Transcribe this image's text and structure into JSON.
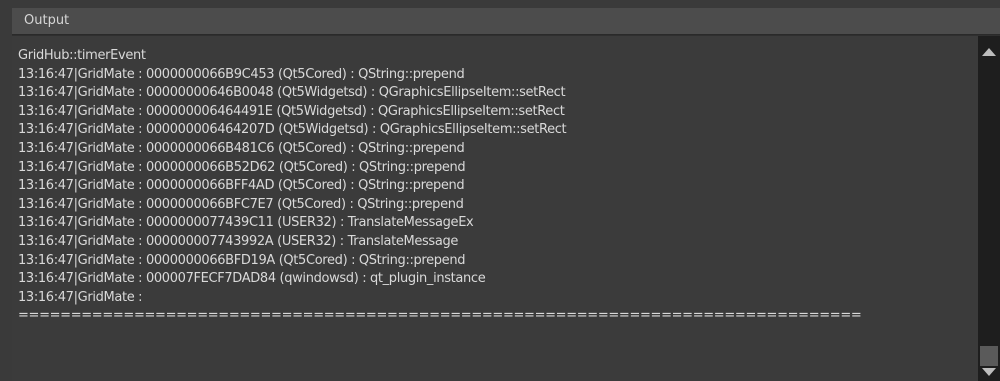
{
  "panel": {
    "title": "Output"
  },
  "log": {
    "lines": [
      "GridHub::timerEvent",
      "13:16:47|GridMate : 0000000066B9C453 (Qt5Cored) : QString::prepend",
      "13:16:47|GridMate : 00000000646B0048 (Qt5Widgetsd) : QGraphicsEllipseItem::setRect",
      "13:16:47|GridMate : 000000006464491E (Qt5Widgetsd) : QGraphicsEllipseItem::setRect",
      "13:16:47|GridMate : 000000006464207D (Qt5Widgetsd) : QGraphicsEllipseItem::setRect",
      "13:16:47|GridMate : 0000000066B481C6 (Qt5Cored) : QString::prepend",
      "13:16:47|GridMate : 0000000066B52D62 (Qt5Cored) : QString::prepend",
      "13:16:47|GridMate : 0000000066BFF4AD (Qt5Cored) : QString::prepend",
      "13:16:47|GridMate : 0000000066BFC7E7 (Qt5Cored) : QString::prepend",
      "13:16:47|GridMate : 0000000077439C11 (USER32) : TranslateMessageEx",
      "13:16:47|GridMate : 000000007743992A (USER32) : TranslateMessage",
      "13:16:47|GridMate : 0000000066BFD19A (Qt5Cored) : QString::prepend",
      "13:16:47|GridMate : 000007FECF7DAD84 (qwindowsd) : qt_plugin_instance",
      "13:16:47|GridMate :",
      "================================================================================"
    ]
  },
  "scrollbar": {
    "up_icon": "arrow-up-icon",
    "down_icon": "arrow-down-icon"
  }
}
